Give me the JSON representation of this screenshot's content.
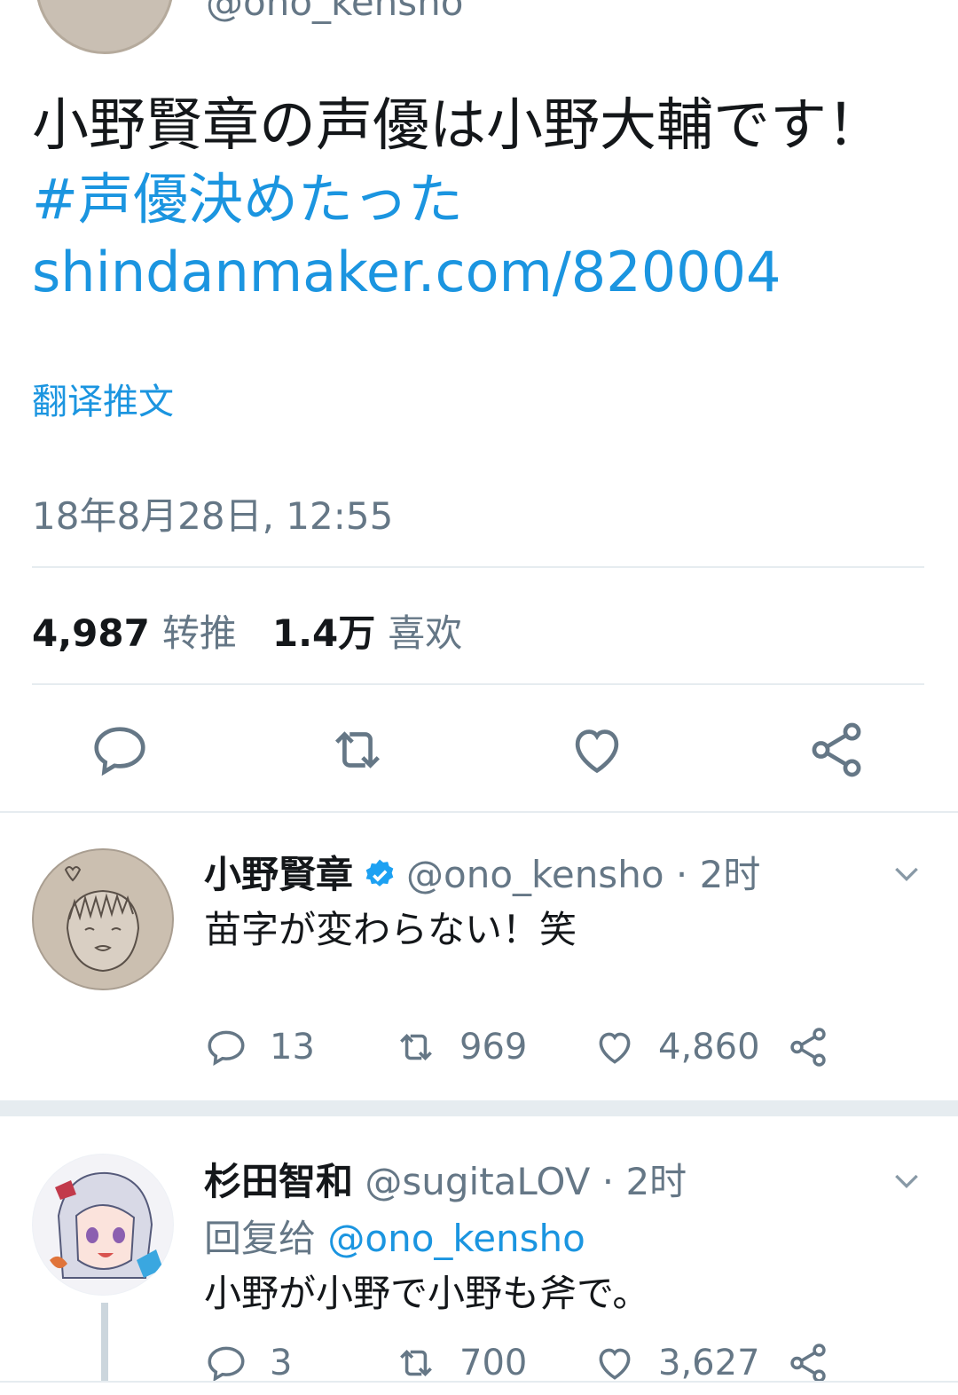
{
  "top": {
    "handle_partial": "@ono_kensho"
  },
  "main_tweet": {
    "text": "小野賢章の声優は小野大輔です！",
    "hashtag": "#声優決めたった",
    "link": "shindanmaker.com/820004",
    "translate_label": "翻译推文",
    "timestamp": "18年8月28日, 12:55",
    "retweets_count": "4,987",
    "retweets_label": "转推",
    "likes_count": "1.4万",
    "likes_label": "喜欢"
  },
  "replies": [
    {
      "name": "小野賢章",
      "verified": true,
      "handle": "@ono_kensho",
      "separator": "·",
      "time": "2时",
      "text": "苗字が変わらない！笑",
      "reply_count": "13",
      "retweet_count": "969",
      "like_count": "4,860"
    },
    {
      "name": "杉田智和",
      "verified": false,
      "handle": "@sugitaLOV",
      "separator": "·",
      "time": "2时",
      "reply_to_label": "回复给",
      "reply_to_mention": "@ono_kensho",
      "text": "小野が小野で小野も斧で。",
      "reply_count": "3",
      "retweet_count": "700",
      "like_count": "3,627"
    }
  ],
  "icons": {
    "reply": "speech-bubble-icon",
    "retweet": "retweet-icon",
    "like": "heart-icon",
    "share": "share-icon",
    "more": "chevron-down-icon",
    "verified": "verified-badge-icon"
  },
  "colors": {
    "link": "#1b95e0",
    "muted": "#657786",
    "text": "#14171a",
    "divider": "#e6ecf0"
  }
}
